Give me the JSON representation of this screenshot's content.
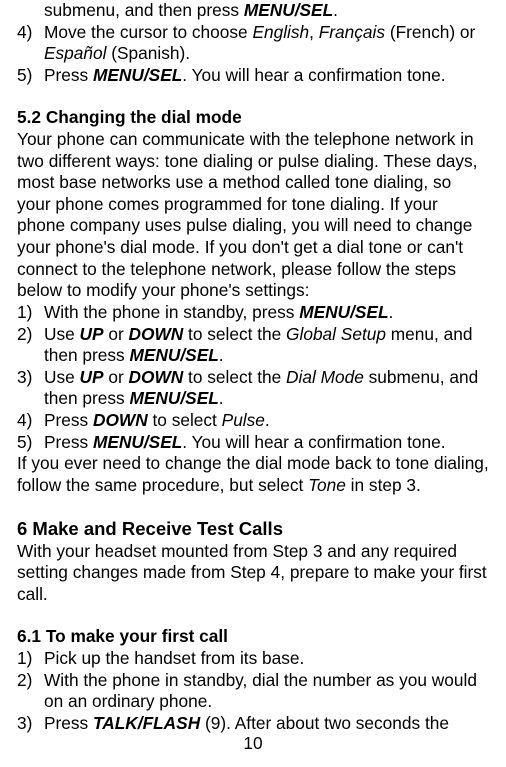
{
  "frag1": "submenu, and then press ",
  "menusel": "MENU/SEL",
  "dot": ".",
  "li4a": "Move the cursor to choose ",
  "english": "English",
  "comma": ", ",
  "francais": "Français",
  "french_paren": " (French) or ",
  "espanol": "Español",
  "spanish_paren": " (Spanish).",
  "li5a": "Press ",
  "confirm": ". You will hear a confirmation tone.",
  "h52": "5.2 Changing the dial mode",
  "p52": "Your phone can communicate with the telephone network in two different ways: tone dialing or pulse dialing. These days, most base networks use a method called tone dialing, so your phone comes programmed for tone dialing. If your phone company uses pulse dialing, you will need to change your phone's dial mode. If you don't get a dial tone or can't connect to the telephone network, please follow the steps below to modify your phone's settings:",
  "s2_1a": "With the phone in standby, press ",
  "s2_2a": "Use ",
  "up": "UP",
  "or": " or ",
  "down": "DOWN",
  "s2_2b": " to select the ",
  "globalsetup": "Global Setup",
  "s2_2c": " menu, and then press ",
  "s2_3b": " to select the ",
  "dialmode": "Dial Mode",
  "s2_3c": " submenu, and then press ",
  "s2_4a": "Press ",
  "s2_4b": " to select ",
  "pulse": "Pulse",
  "p52tail1": "If you ever need to change the dial mode back to tone dialing, follow the same procedure, but select ",
  "tone": "Tone",
  "p52tail2": " in step 3.",
  "h6": "6 Make and Receive Test Calls",
  "p6": "With your headset mounted from Step 3 and any required setting changes made from Step 4, prepare to make your first call.",
  "h61": "6.1 To make your first call",
  "s6_1": "Pick up the handset from its base.",
  "s6_2": "With the phone in standby, dial the number as you would on an ordinary phone.",
  "s6_3a": "Press ",
  "talkflash": "TALK/FLASH",
  "s6_3b": " (9). After about two seconds the",
  "n1": "1)",
  "n2": "2)",
  "n3": "3)",
  "n4": "4)",
  "n5": "5)",
  "pagenum": "10"
}
